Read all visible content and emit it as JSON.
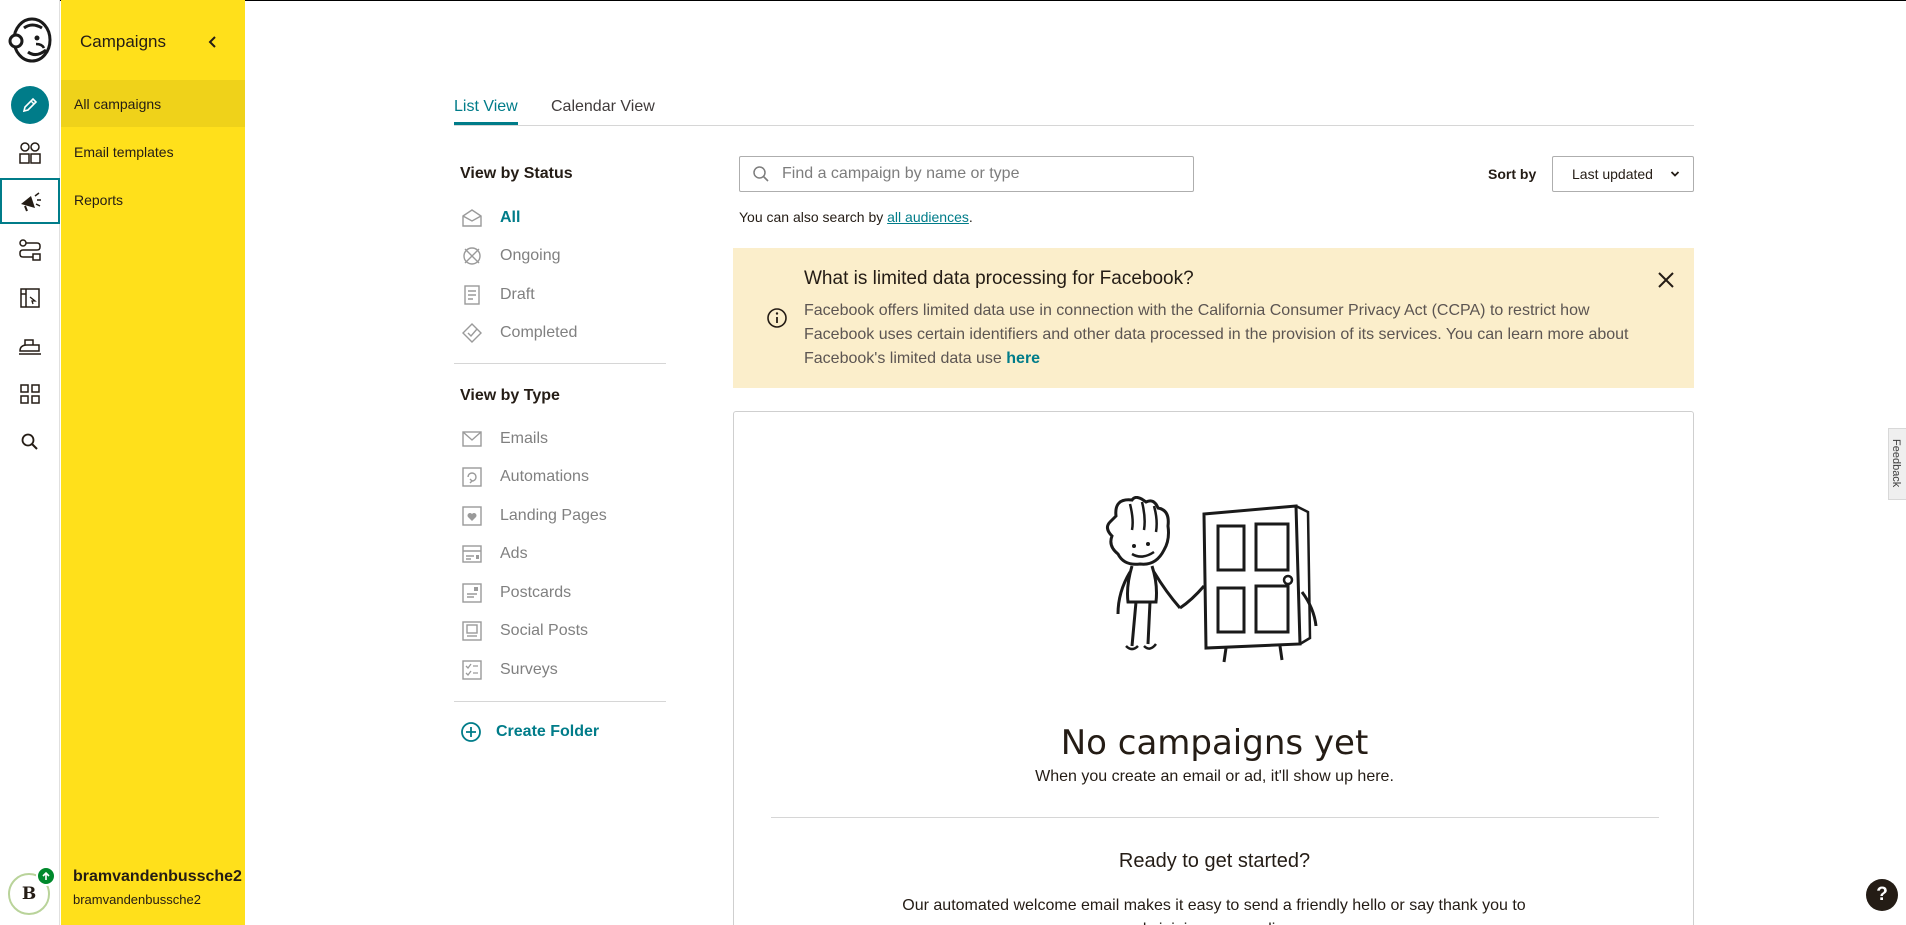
{
  "rail": {
    "icons": [
      "mailchimp-logo",
      "create-icon",
      "audience-icon",
      "campaigns-icon",
      "automations-icon",
      "website-icon",
      "content-icon",
      "integrations-icon",
      "search-icon"
    ],
    "avatar_letter": "B"
  },
  "sidebar": {
    "title": "Campaigns",
    "items": [
      {
        "label": "All campaigns",
        "active": true
      },
      {
        "label": "Email templates",
        "active": false
      },
      {
        "label": "Reports",
        "active": false
      }
    ],
    "user": {
      "name": "bramvandenbussche2",
      "account": "bramvandenbussche2"
    }
  },
  "tabs": [
    {
      "label": "List View",
      "active": true
    },
    {
      "label": "Calendar View",
      "active": false
    }
  ],
  "filters": {
    "status_heading": "View by Status",
    "status": [
      {
        "label": "All",
        "icon": "all-campaigns-icon",
        "active": true
      },
      {
        "label": "Ongoing",
        "icon": "ongoing-icon",
        "active": false
      },
      {
        "label": "Draft",
        "icon": "draft-icon",
        "active": false
      },
      {
        "label": "Completed",
        "icon": "completed-icon",
        "active": false
      }
    ],
    "type_heading": "View by Type",
    "types": [
      {
        "label": "Emails",
        "icon": "email-icon"
      },
      {
        "label": "Automations",
        "icon": "automation-icon"
      },
      {
        "label": "Landing Pages",
        "icon": "landing-page-icon"
      },
      {
        "label": "Ads",
        "icon": "ads-icon"
      },
      {
        "label": "Postcards",
        "icon": "postcard-icon"
      },
      {
        "label": "Social Posts",
        "icon": "social-post-icon"
      },
      {
        "label": "Surveys",
        "icon": "survey-icon"
      }
    ],
    "create_folder": "Create Folder"
  },
  "search": {
    "placeholder": "Find a campaign by name or type",
    "value": "",
    "hint_prefix": "You can also search by ",
    "hint_link": "all audiences",
    "hint_suffix": "."
  },
  "sort": {
    "label": "Sort by",
    "selected": "Last updated"
  },
  "notice": {
    "title": "What is limited data processing for Facebook?",
    "body": "Facebook offers limited data use in connection with the California Consumer Privacy Act (CCPA) to restrict how Facebook uses certain identifiers and other data processed in the provision of its services. You can learn more about Facebook's limited data use ",
    "link": "here"
  },
  "empty_state": {
    "title": "No campaigns yet",
    "subtitle": "When you create an email or ad, it'll show up here.",
    "ready_title": "Ready to get started?",
    "ready_desc": "Our automated welcome email makes it easy to send a friendly hello or say thank you to newly joining your audience."
  },
  "feedback_label": "Feedback",
  "help_label": "?",
  "colors": {
    "brand_yellow": "#ffe01b",
    "accent_teal": "#007c89",
    "notice_bg": "#fbeecb"
  }
}
